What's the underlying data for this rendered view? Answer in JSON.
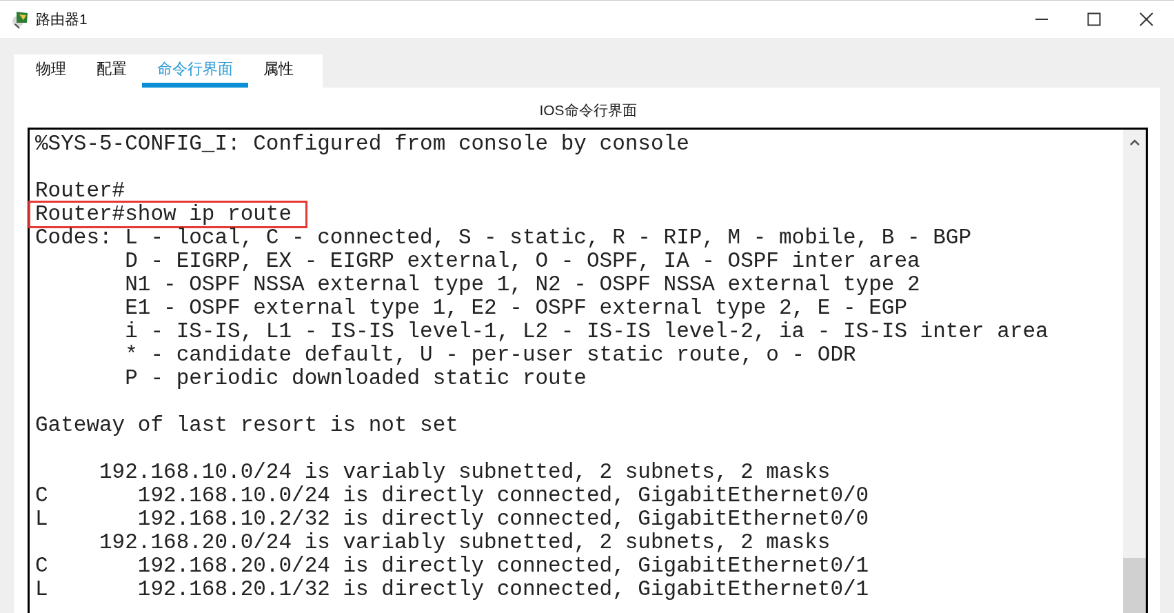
{
  "window": {
    "title": "路由器1"
  },
  "tabs": [
    {
      "label": "物理",
      "selected": false
    },
    {
      "label": "配置",
      "selected": false
    },
    {
      "label": "命令行界面",
      "selected": true
    },
    {
      "label": "属性",
      "selected": false
    }
  ],
  "panel_title": "IOS命令行界面",
  "terminal": {
    "lines": [
      {
        "kind": "text",
        "text": "%SYS-5-CONFIG_I: Configured from console by console",
        "highlighted": false
      },
      {
        "kind": "blank"
      },
      {
        "kind": "text",
        "text": "Router#",
        "highlighted": false
      },
      {
        "kind": "text",
        "text": "Router#show ip route",
        "highlighted": true
      },
      {
        "kind": "text",
        "text": "Codes: L - local, C - connected, S - static, R - RIP, M - mobile, B - BGP",
        "highlighted": false
      },
      {
        "kind": "text",
        "text": "       D - EIGRP, EX - EIGRP external, O - OSPF, IA - OSPF inter area",
        "highlighted": false
      },
      {
        "kind": "text",
        "text": "       N1 - OSPF NSSA external type 1, N2 - OSPF NSSA external type 2",
        "highlighted": false
      },
      {
        "kind": "text",
        "text": "       E1 - OSPF external type 1, E2 - OSPF external type 2, E - EGP",
        "highlighted": false
      },
      {
        "kind": "text",
        "text": "       i - IS-IS, L1 - IS-IS level-1, L2 - IS-IS level-2, ia - IS-IS inter area",
        "highlighted": false
      },
      {
        "kind": "text",
        "text": "       * - candidate default, U - per-user static route, o - ODR",
        "highlighted": false
      },
      {
        "kind": "text",
        "text": "       P - periodic downloaded static route",
        "highlighted": false
      },
      {
        "kind": "blank"
      },
      {
        "kind": "text",
        "text": "Gateway of last resort is not set",
        "highlighted": false
      },
      {
        "kind": "blank"
      },
      {
        "kind": "text",
        "text": "     192.168.10.0/24 is variably subnetted, 2 subnets, 2 masks",
        "highlighted": false
      },
      {
        "kind": "text",
        "text": "C       192.168.10.0/24 is directly connected, GigabitEthernet0/0",
        "highlighted": false
      },
      {
        "kind": "text",
        "text": "L       192.168.10.2/32 is directly connected, GigabitEthernet0/0",
        "highlighted": false
      },
      {
        "kind": "text",
        "text": "     192.168.20.0/24 is variably subnetted, 2 subnets, 2 masks",
        "highlighted": false
      },
      {
        "kind": "text",
        "text": "C       192.168.20.0/24 is directly connected, GigabitEthernet0/1",
        "highlighted": false
      },
      {
        "kind": "text",
        "text": "L       192.168.20.1/32 is directly connected, GigabitEthernet0/1",
        "highlighted": false
      }
    ]
  }
}
